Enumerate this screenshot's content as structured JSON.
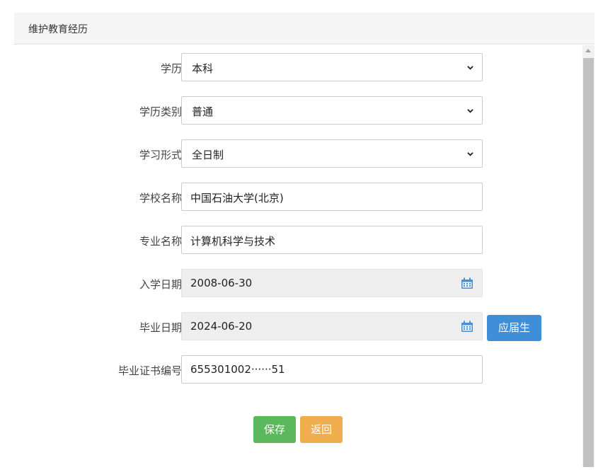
{
  "header": {
    "title": "维护教育经历"
  },
  "fields": {
    "degree": {
      "label": "学历",
      "value": "本科"
    },
    "degree_type": {
      "label": "学历类别",
      "value": "普通"
    },
    "study_mode": {
      "label": "学习形式",
      "value": "全日制"
    },
    "school": {
      "label": "学校名称",
      "value": "中国石油大学(北京)"
    },
    "major": {
      "label": "专业名称",
      "value": "计算机科学与技术"
    },
    "start_date": {
      "label": "入学日期",
      "value": "2008-06-30"
    },
    "end_date": {
      "label": "毕业日期",
      "value": "2024-06-20"
    },
    "cert_no": {
      "label": "毕业证书编号",
      "value": "655301002······51"
    }
  },
  "buttons": {
    "graduate": "应届生",
    "save": "保存",
    "back": "返回"
  },
  "colors": {
    "primary": "#3f8ed8",
    "success": "#5cb85c",
    "warning": "#f0ad4e"
  },
  "icons": {
    "select_arrow": "chevron-down-icon",
    "date": "calendar-icon",
    "scroll_up": "scroll-up-arrow-icon"
  }
}
